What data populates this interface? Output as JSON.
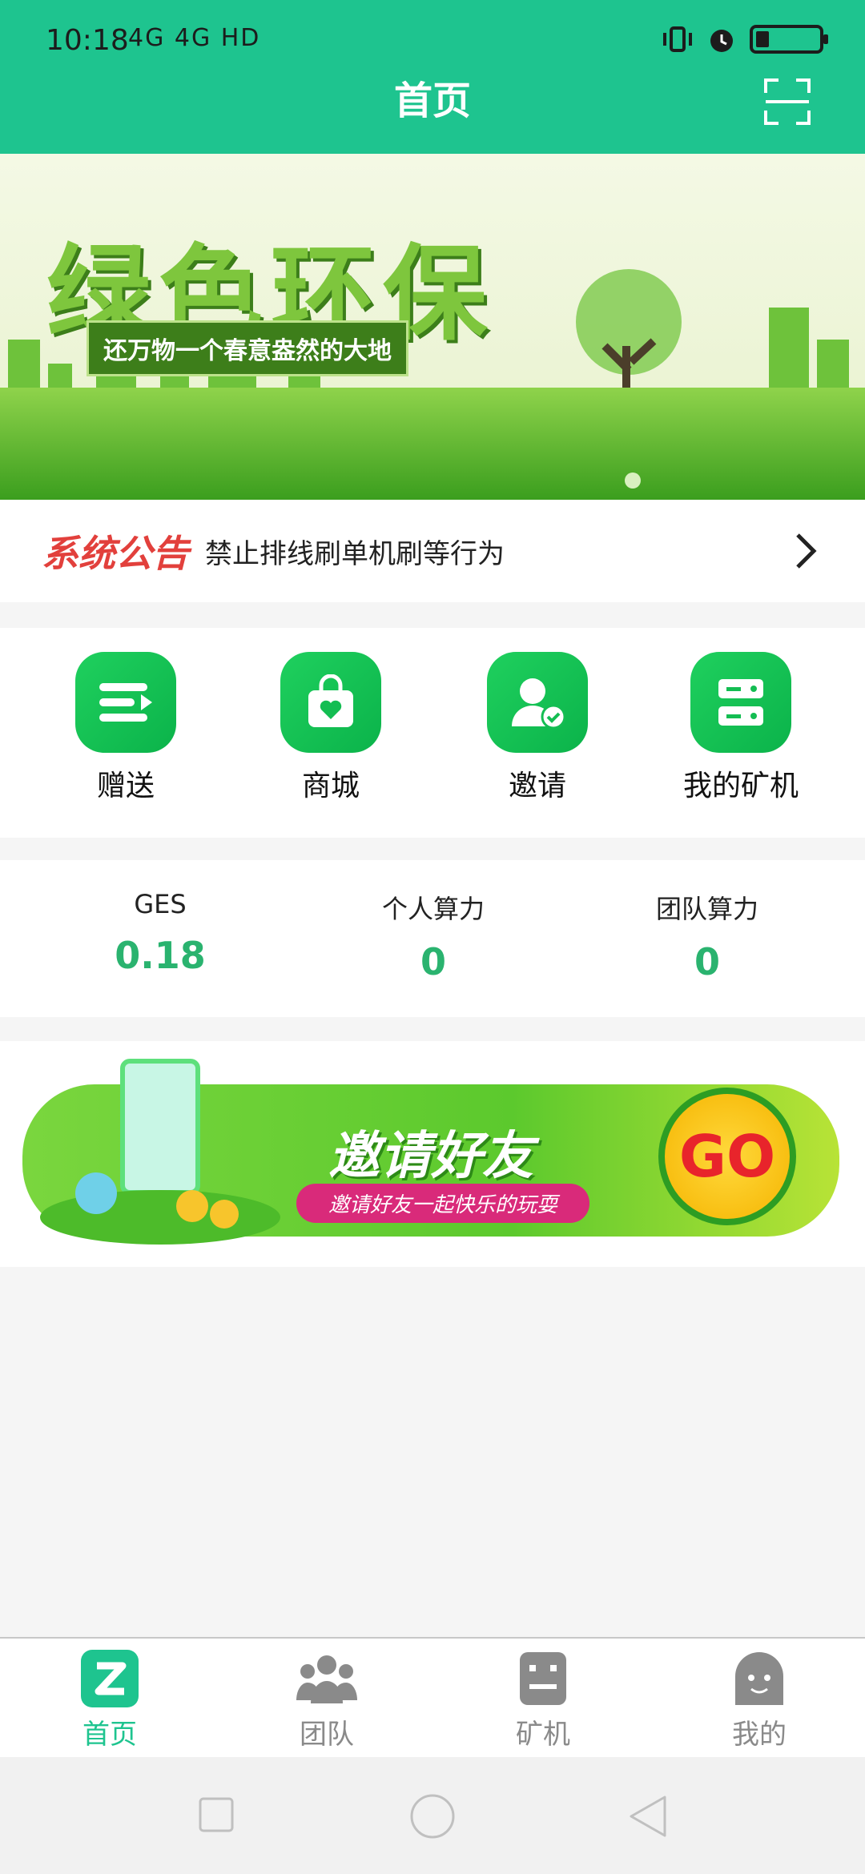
{
  "status": {
    "time": "10:18",
    "signal": "4G 4G HD"
  },
  "header": {
    "title": "首页"
  },
  "banner": {
    "title": "绿色环保",
    "subtitle": "还万物一个春意盎然的大地"
  },
  "notice": {
    "badge": "系统公告",
    "text": "禁止排线刷单机刷等行为"
  },
  "shortcuts": [
    {
      "label": "赠送",
      "icon": "transfer-icon"
    },
    {
      "label": "商城",
      "icon": "shopping-bag-icon"
    },
    {
      "label": "邀请",
      "icon": "invite-user-icon"
    },
    {
      "label": "我的矿机",
      "icon": "server-icon"
    }
  ],
  "stats": [
    {
      "label": "GES",
      "value": "0.18"
    },
    {
      "label": "个人算力",
      "value": "0"
    },
    {
      "label": "团队算力",
      "value": "0"
    }
  ],
  "invite_banner": {
    "title": "邀请好友",
    "subtitle": "邀请好友一起快乐的玩耍",
    "go": "GO"
  },
  "nav": [
    {
      "label": "首页",
      "icon": "home-z-icon",
      "active": true
    },
    {
      "label": "团队",
      "icon": "team-icon",
      "active": false
    },
    {
      "label": "矿机",
      "icon": "robot-icon",
      "active": false
    },
    {
      "label": "我的",
      "icon": "profile-icon",
      "active": false
    }
  ],
  "colors": {
    "primary": "#1ec48f",
    "stat_value": "#2ab36f",
    "nav_active": "#1ec48f",
    "nav_inactive": "#8a8a8a"
  }
}
